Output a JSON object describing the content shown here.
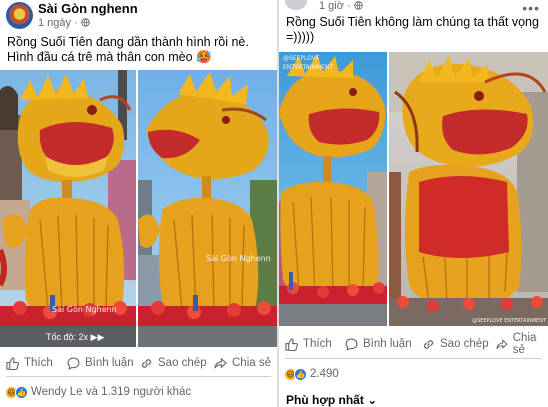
{
  "left_post": {
    "page_name": "Sài Gòn nghenn",
    "time": "1 ngày",
    "caption": "Rồng Suối Tiên đang dần thành hình rồi nè. Hình đầu cá trê mà thân con mèo 🥵",
    "video_badge": "Tốc độ: 2x ▶▶",
    "watermark": "Sài Gòn Nghenn",
    "actions": {
      "like": "Thích",
      "comment": "Bình luận",
      "copy": "Sao chép",
      "share": "Chia sẻ"
    },
    "reactions_text": "Wendy Le và 1.319 người khác"
  },
  "right_post": {
    "time": "1 giờ",
    "caption": "Rồng Suối Tiên không làm chúng ta thất vọng =)))))",
    "watermark_top": "@SEEPLOVE ENTERTAINMENT",
    "watermark_bottom": "@SEEPLOVE ENTERTAINMENT",
    "actions": {
      "like": "Thích",
      "comment": "Bình luận",
      "copy": "Sao chép",
      "share": "Chia sẻ"
    },
    "reactions_text": "2.490",
    "sort_label": "Phù hợp nhất ⌄"
  },
  "colors": {
    "accent": "#1877f2",
    "muted": "#65676b",
    "dragon_gold": "#e0a318",
    "dragon_red": "#d13a2c"
  }
}
